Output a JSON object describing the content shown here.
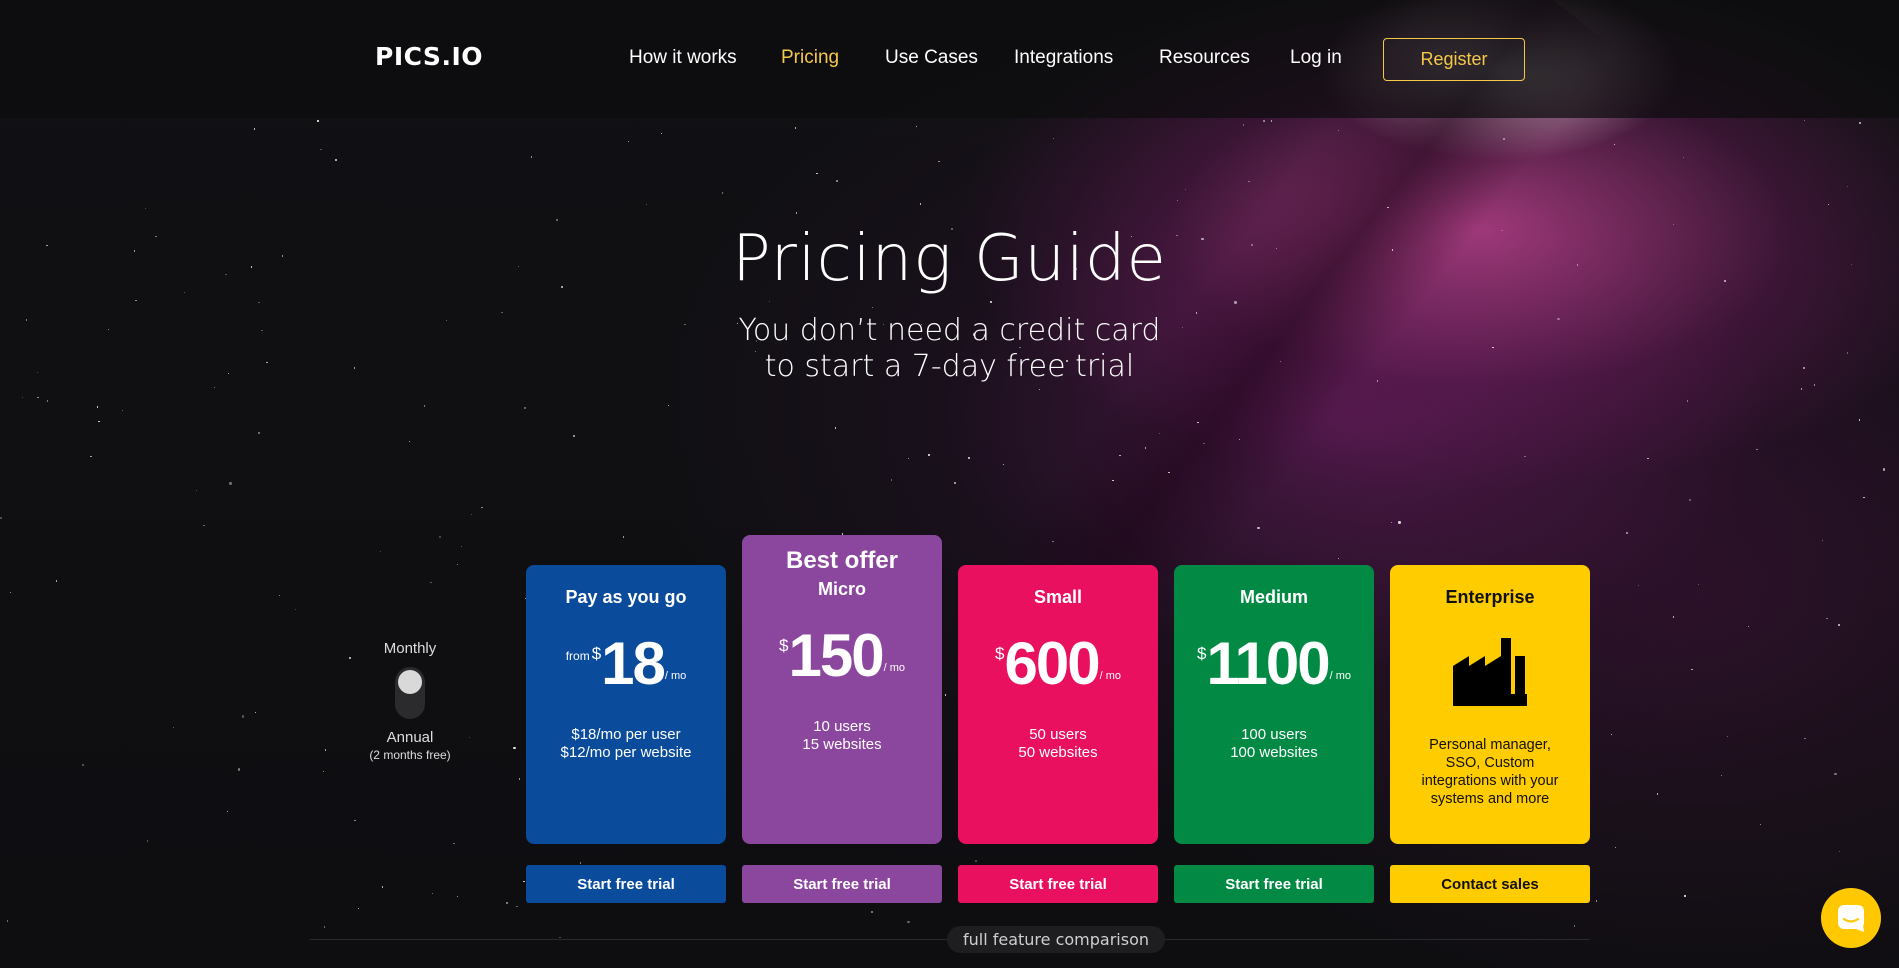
{
  "nav": {
    "logo": "PICS.IO",
    "links": [
      {
        "label": "How it works",
        "active": false
      },
      {
        "label": "Pricing",
        "active": true
      },
      {
        "label": "Use Cases",
        "active": false
      },
      {
        "label": "Integrations",
        "active": false
      },
      {
        "label": "Resources",
        "active": false
      },
      {
        "label": "Log in",
        "active": false
      }
    ],
    "register": "Register"
  },
  "hero": {
    "title": "Pricing Guide",
    "subtitle_line1": "You don’t need a credit card",
    "subtitle_line2": "to start a 7-day free trial"
  },
  "billing": {
    "monthly": "Monthly",
    "annual": "Annual",
    "annual_note": "(2 months free)",
    "selected": "Monthly"
  },
  "plans": [
    {
      "name": "Pay as you go",
      "from": "from",
      "currency": "$",
      "price": "18",
      "per": "/ mo",
      "desc_line1": "$18/mo per user",
      "desc_line2": "$12/mo per website",
      "cta": "Start free trial",
      "color": "#0a4b9c"
    },
    {
      "badge": "Best offer",
      "name": "Micro",
      "currency": "$",
      "price": "150",
      "per": "/ mo",
      "desc_line1": "10 users",
      "desc_line2": "15 websites",
      "cta": "Start free trial",
      "color": "#8b469e"
    },
    {
      "name": "Small",
      "currency": "$",
      "price": "600",
      "per": "/ mo",
      "desc_line1": "50 users",
      "desc_line2": "50 websites",
      "cta": "Start free trial",
      "color": "#e8105f"
    },
    {
      "name": "Medium",
      "currency": "$",
      "price": "1100",
      "per": "/ mo",
      "desc_line1": "100 users",
      "desc_line2": "100 websites",
      "cta": "Start free trial",
      "color": "#028a44"
    },
    {
      "name": "Enterprise",
      "icon": "factory-icon",
      "desc": "Personal manager, SSO, Custom integrations with your systems and more",
      "cta": "Contact sales",
      "color": "#ffcc00"
    }
  ],
  "comparison": "full feature comparison",
  "chat": {
    "icon": "chat-icon",
    "color": "#ffc800"
  }
}
